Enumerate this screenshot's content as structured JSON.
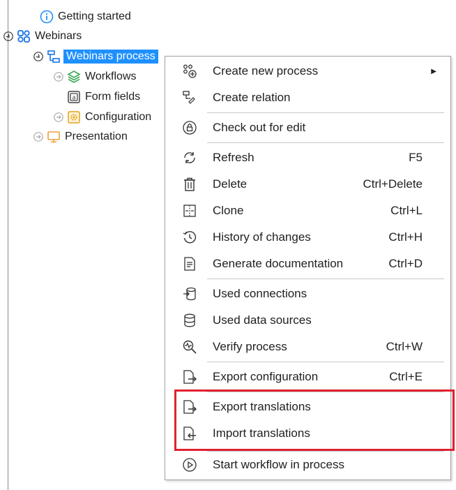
{
  "tree": {
    "getting_started": "Getting started",
    "webinars": "Webinars",
    "webinars_process": "Webinars process",
    "workflows": "Workflows",
    "form_fields": "Form fields",
    "configuration": "Configuration",
    "presentation": "Presentation"
  },
  "menu": {
    "create_new_process": "Create new process",
    "create_relation": "Create relation",
    "check_out": "Check out for edit",
    "refresh": "Refresh",
    "refresh_sc": "F5",
    "delete": "Delete",
    "delete_sc": "Ctrl+Delete",
    "clone": "Clone",
    "clone_sc": "Ctrl+L",
    "history": "History of changes",
    "history_sc": "Ctrl+H",
    "generate_doc": "Generate documentation",
    "generate_doc_sc": "Ctrl+D",
    "used_connections": "Used connections",
    "used_data_sources": "Used data sources",
    "verify_process": "Verify process",
    "verify_process_sc": "Ctrl+W",
    "export_configuration": "Export configuration",
    "export_configuration_sc": "Ctrl+E",
    "export_translations": "Export translations",
    "import_translations": "Import translations",
    "start_workflow": "Start workflow in process"
  },
  "colors": {
    "selection": "#1e90ff",
    "highlight": "#e2202d",
    "info_blue": "#1e90ff",
    "webinars_blue": "#1a73e8",
    "workflows_green": "#3aa655",
    "config_orange": "#e3a21a",
    "presentation_orange": "#e8a33d"
  }
}
